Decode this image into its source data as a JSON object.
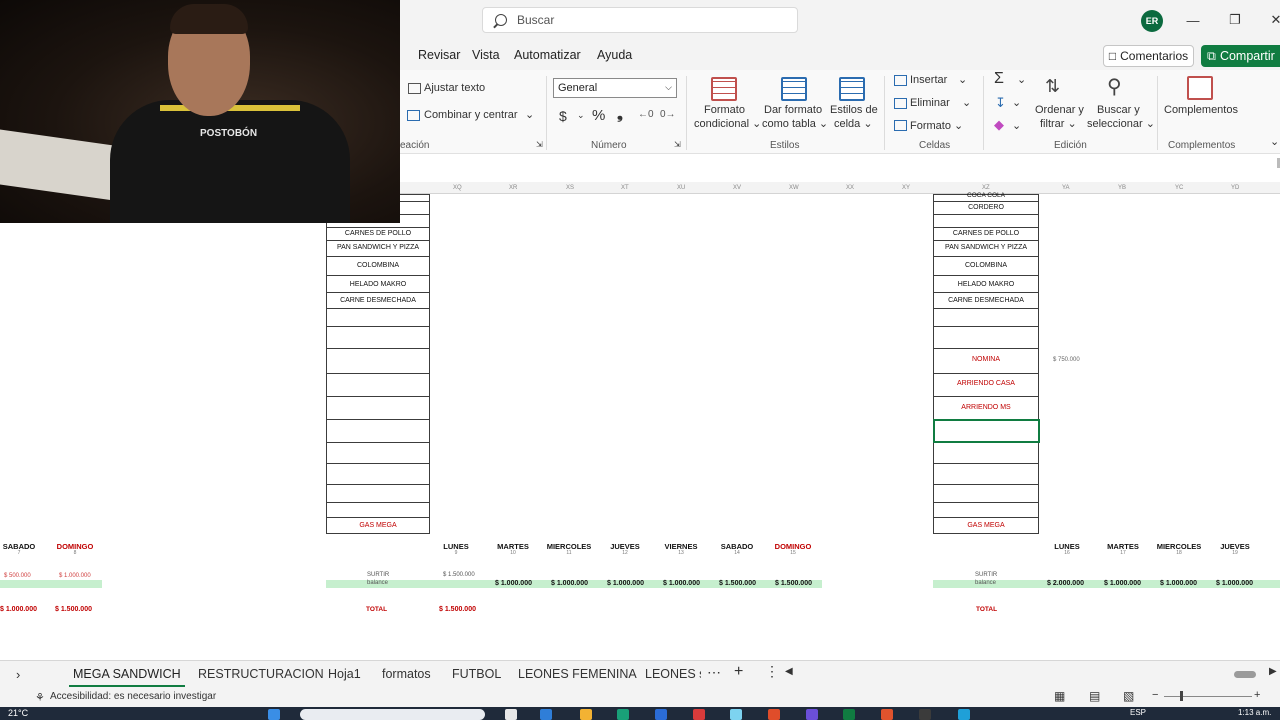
{
  "titlebar": {
    "search_placeholder": "Buscar",
    "user_initials": "ER"
  },
  "menu": {
    "items": [
      "Revisar",
      "Vista",
      "Automatizar",
      "Ayuda"
    ],
    "comments_label": "Comentarios",
    "share_label": "Compartir"
  },
  "ribbon": {
    "wrap_text": "Ajustar texto",
    "merge_center": "Combinar y centrar",
    "alignment_group_partial": "eación",
    "number_format": "General",
    "currency_symbol": "$",
    "percent_symbol": "%",
    "comma_symbol": "❟",
    "number_group": "Número",
    "conditional_format": [
      "Formato",
      "condicional"
    ],
    "format_as_table": [
      "Dar formato",
      "como tabla"
    ],
    "cell_styles": [
      "Estilos de",
      "celda"
    ],
    "styles_group": "Estilos",
    "insert": "Insertar",
    "delete": "Eliminar",
    "format": "Formato",
    "cells_group": "Celdas",
    "sum_symbol": "Σ",
    "sort_filter": [
      "Ordenar y",
      "filtrar"
    ],
    "find_select": [
      "Buscar y",
      "seleccionar"
    ],
    "editing_group": "Edición",
    "addins": "Complementos",
    "addins_group": "Complementos"
  },
  "columns": [
    "XQ",
    "XR",
    "XS",
    "XT",
    "XU",
    "XV",
    "XW",
    "XX",
    "XY",
    "XZ",
    "YA",
    "YB",
    "YC",
    "YD"
  ],
  "left_block": {
    "items": [
      "CARNES DE POLLO",
      "PAN SANDWICH Y PIZZA",
      "COLOMBINA",
      "HELADO MAKRO",
      "CARNE DESMECHADA"
    ],
    "footer": "GAS MEGA"
  },
  "right_block": {
    "top_partial": "COCA COLA",
    "items": [
      "CORDERO",
      "CARNES DE POLLO",
      "PAN SANDWICH Y PIZZA",
      "COLOMBINA",
      "HELADO MAKRO",
      "CARNE DESMECHADA"
    ],
    "red_items": [
      "NOMINA",
      "ARRIENDO CASA",
      "ARRIENDO MS"
    ],
    "nomina_value": "$ 750.000",
    "footer": "GAS MEGA"
  },
  "left_days": [
    {
      "day": "SABADO",
      "num": "7",
      "red": false,
      "small": "$ 500.000",
      "total": "$ 1.000.000"
    },
    {
      "day": "DOMINGO",
      "num": "8",
      "red": true,
      "small": "$ 1.000.000",
      "total": "$ 1.500.000"
    }
  ],
  "mid_week": {
    "days": [
      {
        "day": "LUNES",
        "num": "9",
        "red": false
      },
      {
        "day": "MARTES",
        "num": "10",
        "red": false
      },
      {
        "day": "MIERCOLES",
        "num": "11",
        "red": false
      },
      {
        "day": "JUEVES",
        "num": "12",
        "red": false
      },
      {
        "day": "VIERNES",
        "num": "13",
        "red": false
      },
      {
        "day": "SABADO",
        "num": "14",
        "red": false
      },
      {
        "day": "DOMINGO",
        "num": "15",
        "red": true
      }
    ],
    "surtir_label": "SURTIR",
    "surtir_value": "$ 1.500.000",
    "balance_label": "balance",
    "balance_values": [
      "$ 1.000.000",
      "$ 1.000.000",
      "$ 1.000.000",
      "$ 1.000.000",
      "$ 1.500.000",
      "$ 1.500.000"
    ],
    "total_label": "TOTAL",
    "total_value": "$ 1.500.000"
  },
  "right_week": {
    "days": [
      {
        "day": "LUNES",
        "num": "16"
      },
      {
        "day": "MARTES",
        "num": "17"
      },
      {
        "day": "MIERCOLES",
        "num": "18"
      },
      {
        "day": "JUEVES",
        "num": "19"
      }
    ],
    "surtir_label": "SURTIR",
    "balance_label": "balance",
    "balance_values": [
      "$ 2.000.000",
      "$ 1.000.000",
      "$ 1.000.000",
      "$ 1.000.000"
    ],
    "total_label": "TOTAL"
  },
  "sheet_tabs": [
    "MEGA SANDWICH",
    "RESTRUCTURACION",
    "Hoja1",
    "formatos",
    "FUTBOL",
    "LEONES FEMENINA",
    "LEONES su"
  ],
  "status": {
    "accessibility": "Accesibilidad: es necesario investigar"
  },
  "taskbar": {
    "temperature": "21°C",
    "language": "ESP",
    "time": "1:13 a.m."
  },
  "webcam": {
    "shirt_brand": "POSTOBÓN"
  }
}
